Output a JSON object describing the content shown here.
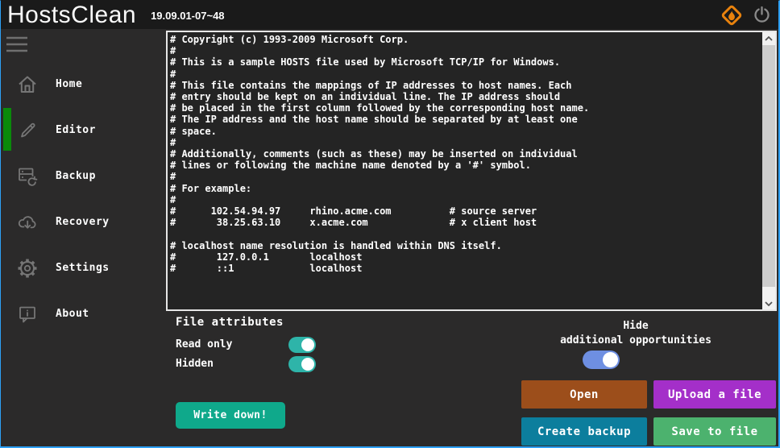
{
  "colors": {
    "accent_blue_border": "#2da0f5",
    "active_green": "#0a8a0a",
    "toggle_teal": "#2eb4a9",
    "toggle_blue": "#6e8fe2",
    "btn_open": "#9c4e1b",
    "btn_upload": "#a42fc9",
    "btn_backup": "#0c7e9d",
    "btn_save": "#4cb26e",
    "btn_write": "#0fa98b",
    "logo_orange": "#e8820d"
  },
  "titlebar": {
    "app_title": "HostsClean",
    "version": "19.09.01-07~48"
  },
  "sidebar": {
    "items": [
      {
        "label": "Home",
        "icon": "home-icon",
        "active": false
      },
      {
        "label": "Editor",
        "icon": "pencil-icon",
        "active": true
      },
      {
        "label": "Backup",
        "icon": "backup-icon",
        "active": false
      },
      {
        "label": "Recovery",
        "icon": "cloud-download-icon",
        "active": false
      },
      {
        "label": "Settings",
        "icon": "gear-icon",
        "active": false
      },
      {
        "label": "About",
        "icon": "info-bubble-icon",
        "active": false
      }
    ]
  },
  "editor": {
    "lines": [
      "# Copyright (c) 1993-2009 Microsoft Corp.",
      "#",
      "# This is a sample HOSTS file used by Microsoft TCP/IP for Windows.",
      "#",
      "# This file contains the mappings of IP addresses to host names. Each",
      "# entry should be kept on an individual line. The IP address should",
      "# be placed in the first column followed by the corresponding host name.",
      "# The IP address and the host name should be separated by at least one",
      "# space.",
      "#",
      "# Additionally, comments (such as these) may be inserted on individual",
      "# lines or following the machine name denoted by a '#' symbol.",
      "#",
      "# For example:",
      "#",
      "#      102.54.94.97     rhino.acme.com          # source server",
      "#       38.25.63.10     x.acme.com              # x client host",
      "",
      "# localhost name resolution is handled within DNS itself.",
      "#       127.0.0.1       localhost",
      "#       ::1             localhost"
    ]
  },
  "attributes_panel": {
    "heading": "File attributes",
    "read_only_label": "Read only",
    "read_only_checked": true,
    "hidden_label": "Hidden",
    "hidden_checked": true
  },
  "opportunities": {
    "label_line1": "Hide",
    "label_line2": "additional opportunities",
    "checked": true
  },
  "buttons": {
    "write_down": "Write down!",
    "open": "Open",
    "upload": "Upload a file",
    "create_backup": "Create backup",
    "save_to_file": "Save to file"
  }
}
